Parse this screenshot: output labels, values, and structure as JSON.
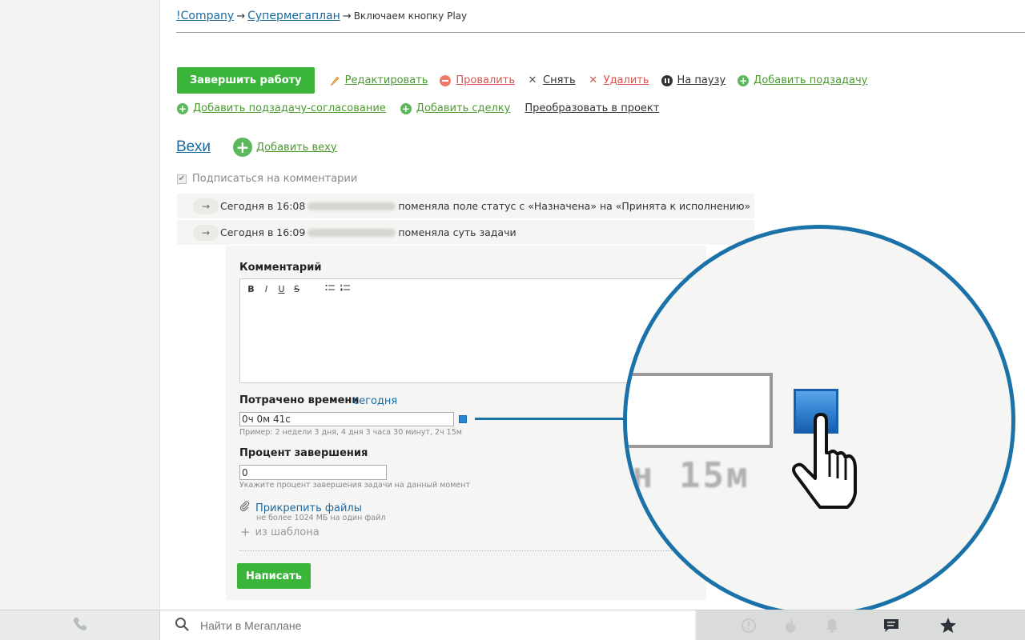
{
  "breadcrumb": {
    "items": [
      "!Company",
      "Супермегаплан"
    ],
    "current": "Включаем кнопку Play",
    "separator": "→"
  },
  "actions": {
    "finish": "Завершить работу",
    "edit": "Редактировать",
    "fail": "Провалить",
    "remove": "Снять",
    "delete": "Удалить",
    "pause": "На паузу",
    "add_subtask": "Добавить подзадачу",
    "add_approval_subtask": "Добавить подзадачу-согласование",
    "add_deal": "Добавить сделку",
    "convert_to_project": "Преобразовать в проект"
  },
  "milestones": {
    "title": "Вехи",
    "add": "Добавить веху"
  },
  "subscribe": {
    "label": "Подписаться на комментарии",
    "checked": true
  },
  "log": [
    {
      "arrow": "→",
      "time": "Сегодня в 16:08",
      "text": "поменяла поле статус с «Назначена» на «Принята к исполнению»"
    },
    {
      "arrow": "→",
      "time": "Сегодня в 16:09",
      "text": "поменяла суть задачи"
    }
  ],
  "comment": {
    "title": "Комментарий",
    "toolbar": {
      "bold": "B",
      "italic": "I",
      "underline": "U",
      "strike": "S"
    },
    "time_label": "Потрачено времени",
    "time_day": "сегодня",
    "time_value": "0ч 0м 41с",
    "time_hint": "Пример: 2 недели 3 дня, 4 дня 3 часа 30 минут, 2ч 15м",
    "percent_label": "Процент завершения",
    "percent_value": "0",
    "percent_hint": "Укажите процент завершения задачи на данный момент",
    "attach": "Прикрепить файлы",
    "attach_hint": "не более 1024 МБ на один файл",
    "from_template": "из шаблона",
    "submit": "Написать"
  },
  "zoom": {
    "text": "н 15м"
  },
  "bottom": {
    "search_placeholder": "Найти в Мегаплане"
  },
  "colors": {
    "accent_green": "#3ab53a",
    "link_blue": "#1a6aa0",
    "zoom_ring": "#1a72a8"
  }
}
